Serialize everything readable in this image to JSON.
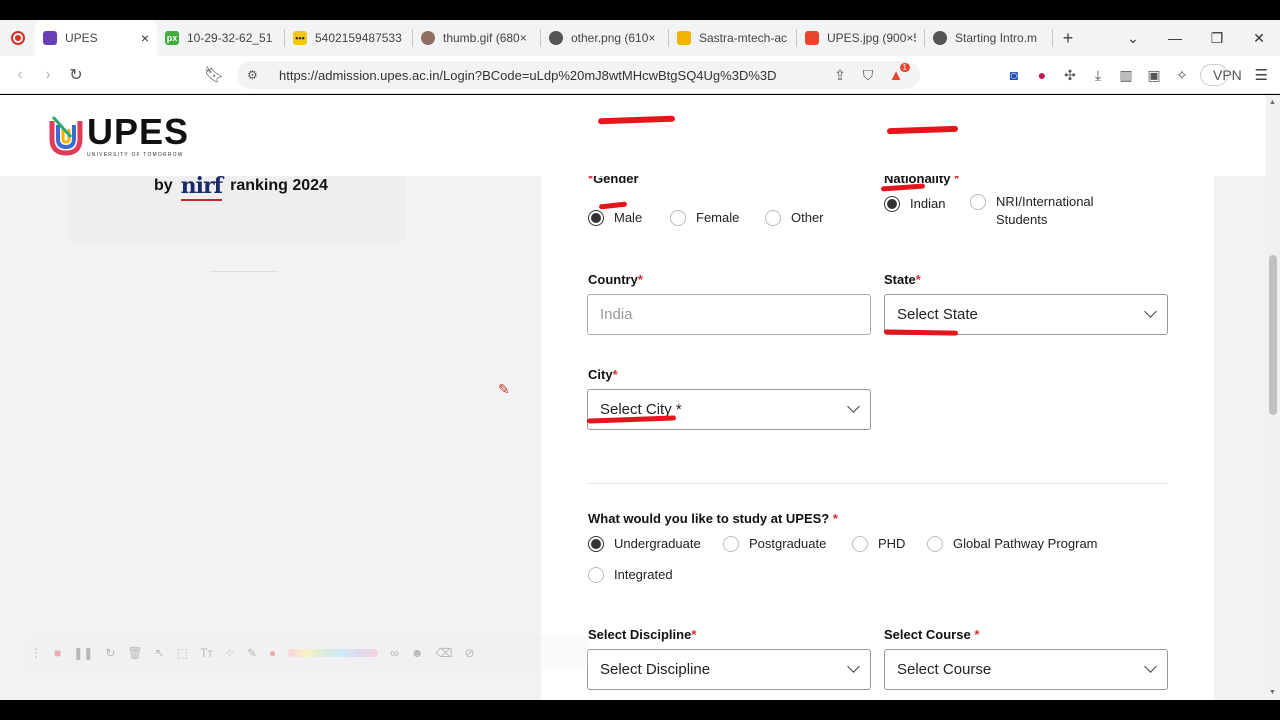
{
  "browser": {
    "tabs": [
      {
        "title": "UPES",
        "active": true,
        "favicon_color": "#6a3fb5"
      },
      {
        "title": "10-29-32-62_51",
        "active": false,
        "favicon_color": "#3fae3f",
        "favicon_text": "px"
      },
      {
        "title": "5402159487533",
        "active": false,
        "favicon_color": "#f5c518"
      },
      {
        "title": "thumb.gif (680×",
        "active": false,
        "favicon_color": "#8d6e63"
      },
      {
        "title": "other.png (610×",
        "active": false,
        "favicon_color": "#555555"
      },
      {
        "title": "Sastra-mtech-ac",
        "active": false,
        "favicon_color": "#f0b400"
      },
      {
        "title": "UPES.jpg (900×5",
        "active": false,
        "favicon_color": "#e8452c"
      },
      {
        "title": "Starting Intro.m",
        "active": false,
        "favicon_color": "#555555"
      }
    ],
    "url": "https://admission.upes.ac.in/Login?BCode=uLdp%20mJ8wtMHcwBtgSQ4Ug%3D%3D",
    "shield_badge": "1",
    "vpn_label": "VPN"
  },
  "header": {
    "logo_text": "UPES",
    "logo_tagline": "UNIVERSITY OF TOMORROW"
  },
  "left": {
    "rank_prefix": "by",
    "rank_logo": "nirf",
    "rank_suffix": "ranking 2024"
  },
  "form": {
    "gender": {
      "label": "Gender",
      "options": [
        "Male",
        "Female",
        "Other"
      ],
      "selected": "Male"
    },
    "nationality": {
      "label": "Nationality",
      "options": [
        "Indian",
        "NRI/International Students"
      ],
      "selected": "Indian"
    },
    "country": {
      "label": "Country",
      "placeholder": "India"
    },
    "state": {
      "label": "State",
      "value": "Select State"
    },
    "city": {
      "label": "City",
      "value": "Select City *"
    },
    "study": {
      "label": "What would you like to study at UPES?",
      "options": [
        "Undergraduate",
        "Postgraduate",
        "PHD",
        "Global Pathway Program",
        "Integrated"
      ],
      "selected": "Undergraduate"
    },
    "discipline": {
      "label": "Select Discipline",
      "value": "Select Discipline"
    },
    "course": {
      "label": "Select Course",
      "value": "Select Course"
    },
    "required_mark": "*"
  },
  "colors": {
    "annotation_red": "#e3161b",
    "required_red": "#d32f2f"
  }
}
